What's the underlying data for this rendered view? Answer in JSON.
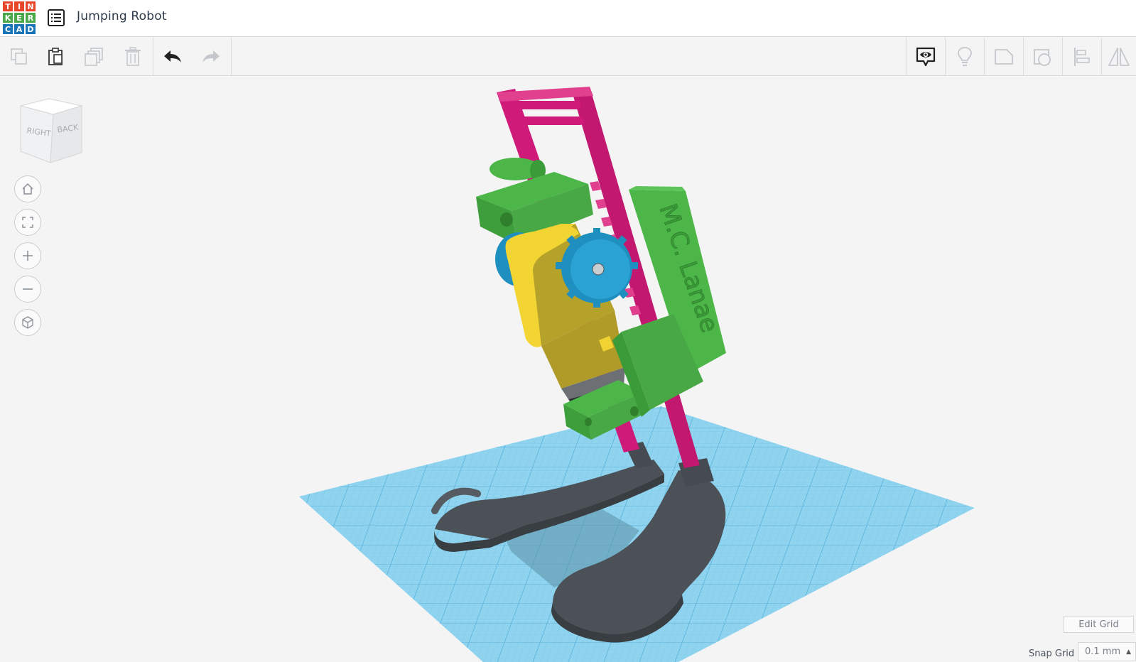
{
  "app": {
    "logo_letters": [
      "T",
      "I",
      "N",
      "K",
      "E",
      "R",
      "C",
      "A",
      "D"
    ],
    "logo_colors": [
      "#e8462a",
      "#e8462a",
      "#e8462a",
      "#4aa84b",
      "#4aa84b",
      "#4aa84b",
      "#1a74b8",
      "#1a74b8",
      "#1a74b8"
    ],
    "title": "Jumping Robot"
  },
  "toolbar": {
    "left_icons": [
      "copy-icon",
      "paste-icon",
      "duplicate-icon",
      "delete-icon",
      "undo-icon",
      "redo-icon"
    ],
    "right_icons": [
      "notes-visibility-icon",
      "light-bulb-icon",
      "shape-note-icon",
      "ruler-shape-icon",
      "align-icon",
      "mirror-icon"
    ]
  },
  "viewcube": {
    "faces": [
      "RIGHT",
      "BACK"
    ]
  },
  "nav": {
    "buttons": [
      "home-view-icon",
      "fit-view-icon",
      "zoom-in-icon",
      "zoom-out-icon",
      "ortho-perspective-icon"
    ]
  },
  "workplane": {
    "color": "#8fd3ef"
  },
  "robot": {
    "engraved_text": "M.C. Lanae"
  },
  "grid": {
    "edit_label": "Edit Grid",
    "snap_label": "Snap Grid",
    "snap_value": "0.1 mm"
  }
}
